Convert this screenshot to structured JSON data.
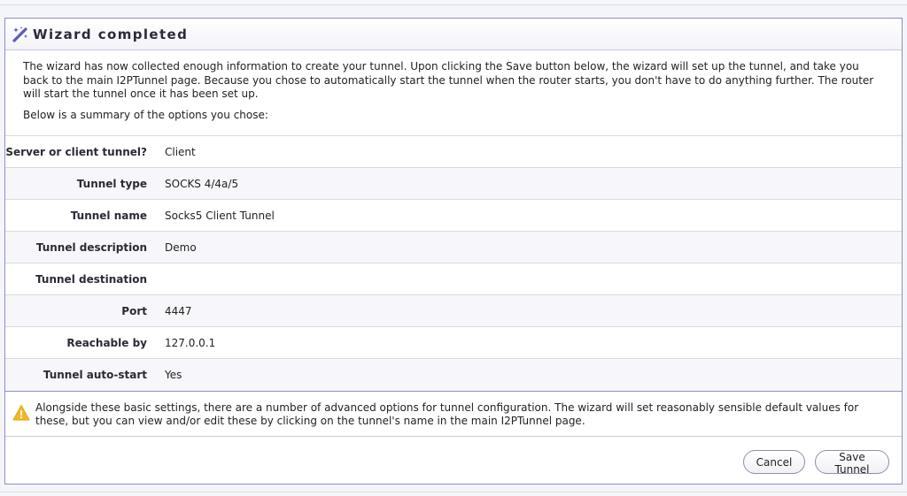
{
  "header": {
    "title": "Wizard completed",
    "icon": "magic-wand-icon"
  },
  "intro": {
    "paragraph": "The wizard has now collected enough information to create your tunnel. Upon clicking the Save button below, the wizard will set up the tunnel, and take you back to the main I2PTunnel page. Because you chose to automatically start the tunnel when the router starts, you don't have to do anything further. The router will start the tunnel once it has been set up.",
    "summary": "Below is a summary of the options you chose:"
  },
  "options": [
    {
      "label": "Server or client tunnel?",
      "value": "Client"
    },
    {
      "label": "Tunnel type",
      "value": "SOCKS 4/4a/5"
    },
    {
      "label": "Tunnel name",
      "value": "Socks5 Client Tunnel"
    },
    {
      "label": "Tunnel description",
      "value": "Demo"
    },
    {
      "label": "Tunnel destination",
      "value": ""
    },
    {
      "label": "Port",
      "value": "4447"
    },
    {
      "label": "Reachable by",
      "value": "127.0.0.1"
    },
    {
      "label": "Tunnel auto-start",
      "value": "Yes"
    }
  ],
  "notice": {
    "icon": "warning-icon",
    "text": "Alongside these basic settings, there are a number of advanced options for tunnel configuration. The wizard will set reasonably sensible default values for these, but you can view and/or edit these by clicking on the tunnel's name in the main I2PTunnel page."
  },
  "buttons": {
    "cancel": "Cancel",
    "save": "Save Tunnel"
  },
  "colors": {
    "accent": "#8d8dc8",
    "warning": "#f2b722"
  }
}
